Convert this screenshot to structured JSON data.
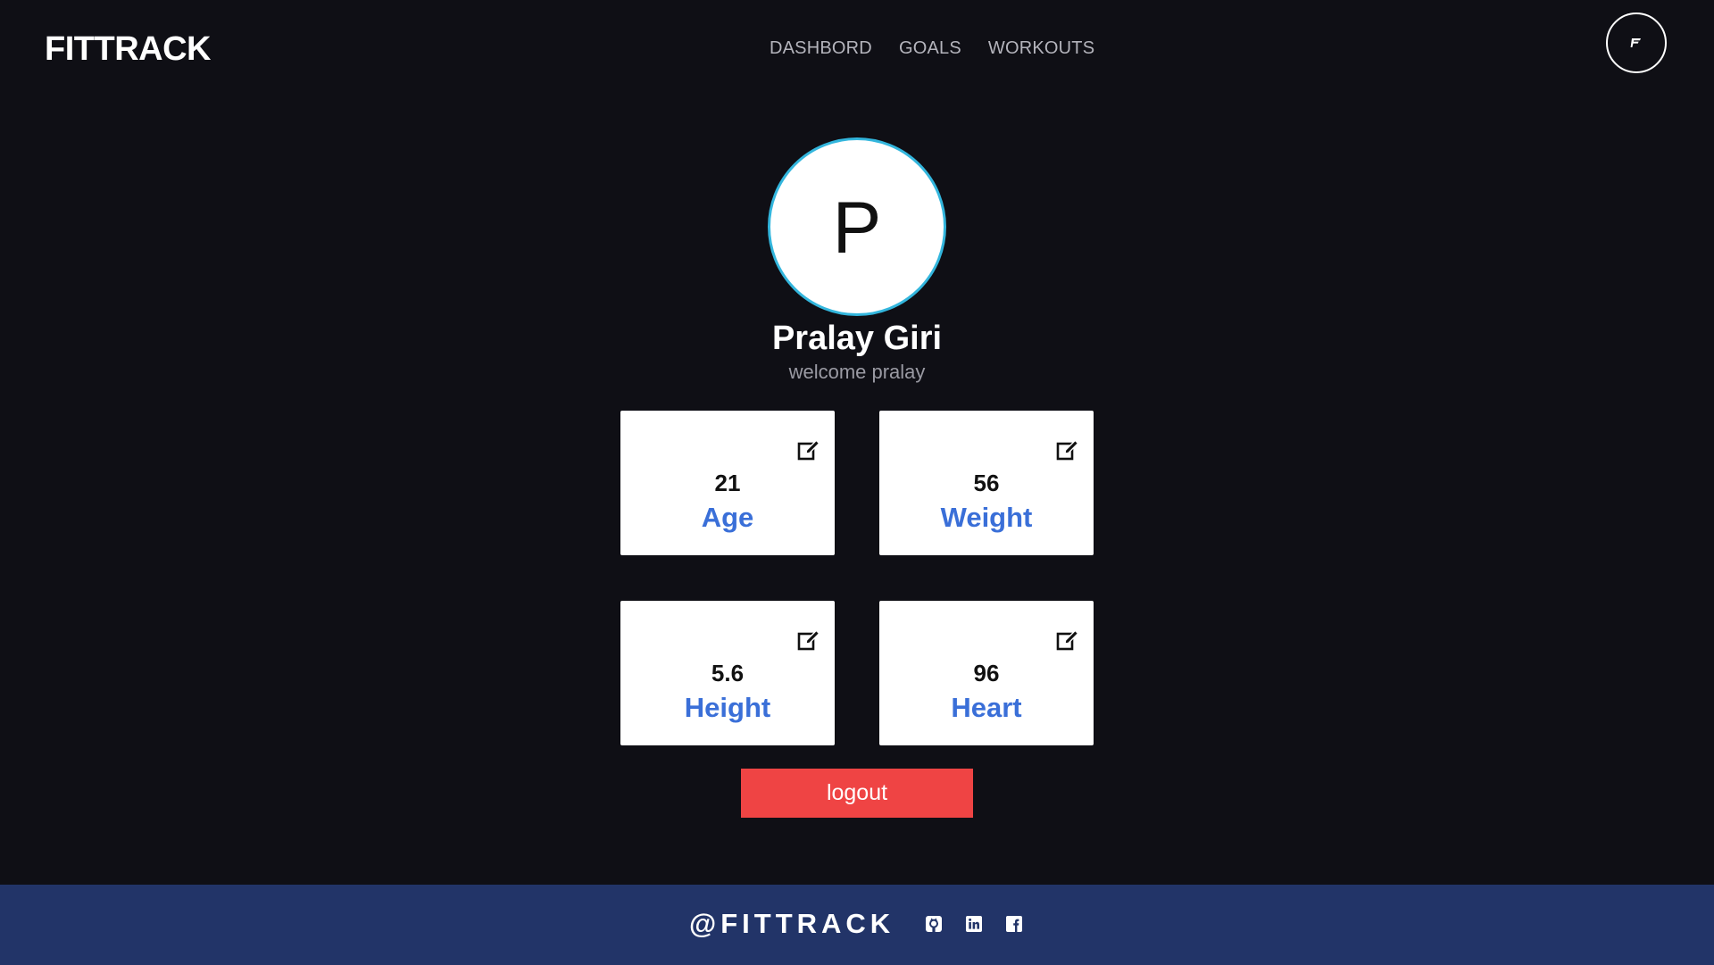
{
  "header": {
    "logo": "FITTRACK",
    "nav": [
      {
        "label": "DASHBORD"
      },
      {
        "label": "GOALS"
      },
      {
        "label": "WORKOUTS"
      }
    ],
    "account_icon": "flag-logo-icon"
  },
  "profile": {
    "initial": "P",
    "name": "Pralay Giri",
    "subtitle": "welcome pralay"
  },
  "stats": [
    {
      "value": "21",
      "label": "Age",
      "icon": "edit-icon"
    },
    {
      "value": "56",
      "label": "Weight",
      "icon": "edit-icon"
    },
    {
      "value": "5.6",
      "label": "Height",
      "icon": "edit-icon"
    },
    {
      "value": "96",
      "label": "Heart",
      "icon": "edit-icon"
    }
  ],
  "logout_label": "logout",
  "footer": {
    "brand": "@FITTRACK",
    "social": [
      {
        "icon": "github-icon"
      },
      {
        "icon": "linkedin-icon"
      },
      {
        "icon": "facebook-icon"
      }
    ]
  },
  "colors": {
    "background": "#0f0f15",
    "accent_label": "#3a6fd8",
    "logout": "#ef4444",
    "footer": "#223468",
    "avatar_border": "#33b6dd"
  }
}
